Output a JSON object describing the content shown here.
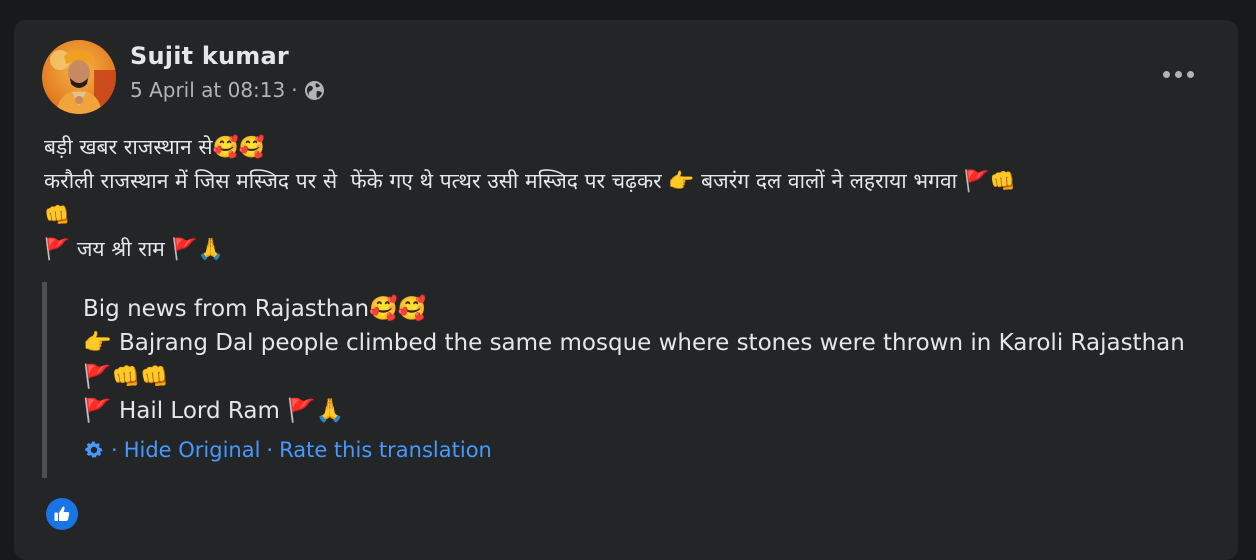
{
  "post": {
    "author": "Sujit kumar",
    "timestamp": "5 April at 08:13",
    "meta_separator": "·",
    "visibility_icon": "globe-icon",
    "more_icon": "more-options-icon",
    "lines": [
      "बड़ी खबर राजस्थान से🥰🥰",
      "करौली राजस्थान में जिस मस्जिद पर से  फेंके गए थे पत्थर उसी मस्जिद पर चढ़कर 👉 बजरंग दल वालों ने लहराया भगवा 🚩👊",
      "👊",
      "🚩 जय श्री राम 🚩🙏"
    ]
  },
  "translation": {
    "lines": [
      "Big news from Rajasthan🥰🥰",
      "👉 Bajrang Dal people climbed the same mosque where stones were thrown in Karoli Rajasthan",
      "🚩👊👊",
      "🚩 Hail Lord Ram 🚩🙏"
    ],
    "settings_icon": "gear-icon",
    "separator": "·",
    "hide_original": "Hide Original",
    "rate": "Rate this translation"
  },
  "reactions": {
    "icon": "like-icon"
  },
  "colors": {
    "background": "#18191a",
    "card": "#242526",
    "text": "#e4e6eb",
    "secondary_text": "#b0b3b8",
    "link": "#4599ff",
    "like_blue": "#1b74e4"
  }
}
